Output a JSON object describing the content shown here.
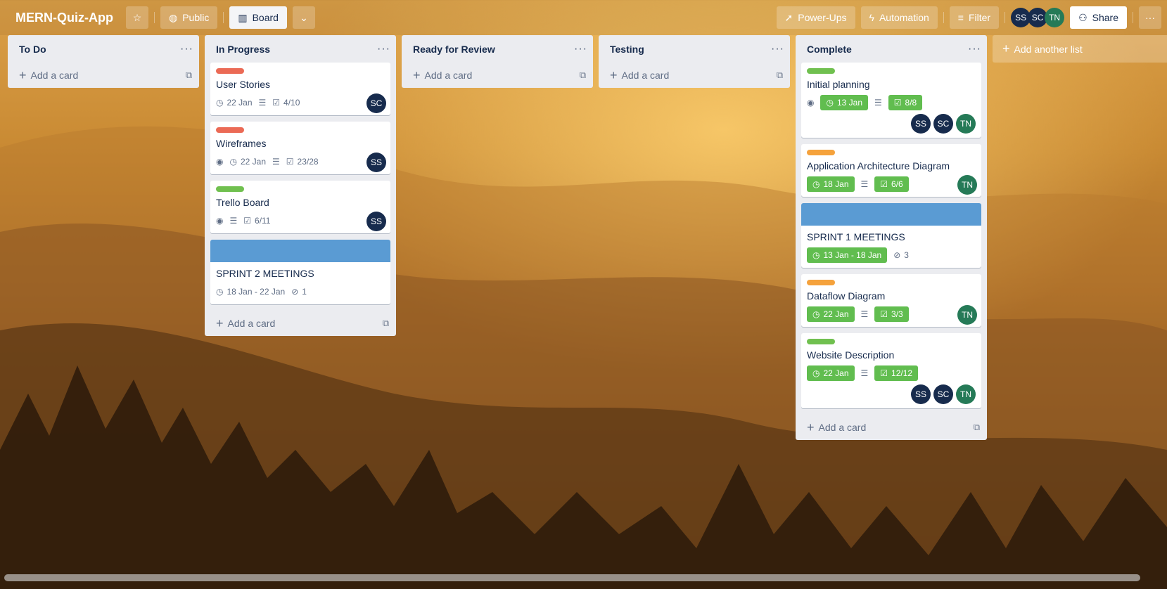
{
  "header": {
    "board_title": "MERN-Quiz-App",
    "visibility_label": "Public",
    "view_label": "Board",
    "powerups_label": "Power-Ups",
    "automation_label": "Automation",
    "filter_label": "Filter",
    "share_label": "Share",
    "members": [
      "SS",
      "SC",
      "TN"
    ]
  },
  "lists": [
    {
      "title": "To Do",
      "add_card": "Add a card",
      "cards": []
    },
    {
      "title": "In Progress",
      "add_card": "Add a card",
      "cards": [
        {
          "label": "red",
          "title": "User Stories",
          "due": "22 Jan",
          "description": true,
          "checklist": "4/10",
          "members": [
            "SC"
          ]
        },
        {
          "label": "red",
          "title": "Wireframes",
          "watch": true,
          "due": "22 Jan",
          "description": true,
          "checklist": "23/28",
          "members": [
            "SS"
          ]
        },
        {
          "label": "green",
          "title": "Trello Board",
          "watch": true,
          "description": true,
          "checklist": "6/11",
          "members": [
            "SS"
          ]
        },
        {
          "cover": "#5a9bd3",
          "title": "SPRINT 2 MEETINGS",
          "due": "18 Jan - 22 Jan",
          "attachments": "1"
        }
      ]
    },
    {
      "title": "Ready for Review",
      "add_card": "Add a card",
      "cards": []
    },
    {
      "title": "Testing",
      "add_card": "Add a card",
      "cards": []
    },
    {
      "title": "Complete",
      "add_card": "Add a card",
      "cards": [
        {
          "label": "green",
          "title": "Initial planning",
          "watch": true,
          "due": "13 Jan",
          "description": true,
          "checklist": "8/8",
          "members": [
            "SS",
            "SC",
            "TN"
          ]
        },
        {
          "label": "orange",
          "title": "Application Architecture Diagram",
          "due": "18 Jan",
          "description": true,
          "checklist": "6/6",
          "members": [
            "TN"
          ]
        },
        {
          "cover": "#5a9bd3",
          "title": "SPRINT 1 MEETINGS",
          "due": "13 Jan - 18 Jan",
          "attachments": "3"
        },
        {
          "label": "orange",
          "title": "Dataflow Diagram",
          "due": "22 Jan",
          "description": true,
          "checklist": "3/3",
          "members": [
            "TN"
          ]
        },
        {
          "label": "green",
          "title": "Website Description",
          "due": "22 Jan",
          "description": true,
          "checklist": "12/12",
          "members": [
            "SS",
            "SC",
            "TN"
          ]
        }
      ]
    }
  ],
  "add_list_label": "Add another list",
  "colors": {
    "label_red": "#eb6a55",
    "label_green": "#70c04f",
    "label_orange": "#f5a23c",
    "complete_badge": "#61bd4f",
    "member_navy": "#172b4d",
    "member_teal": "#257a57"
  }
}
